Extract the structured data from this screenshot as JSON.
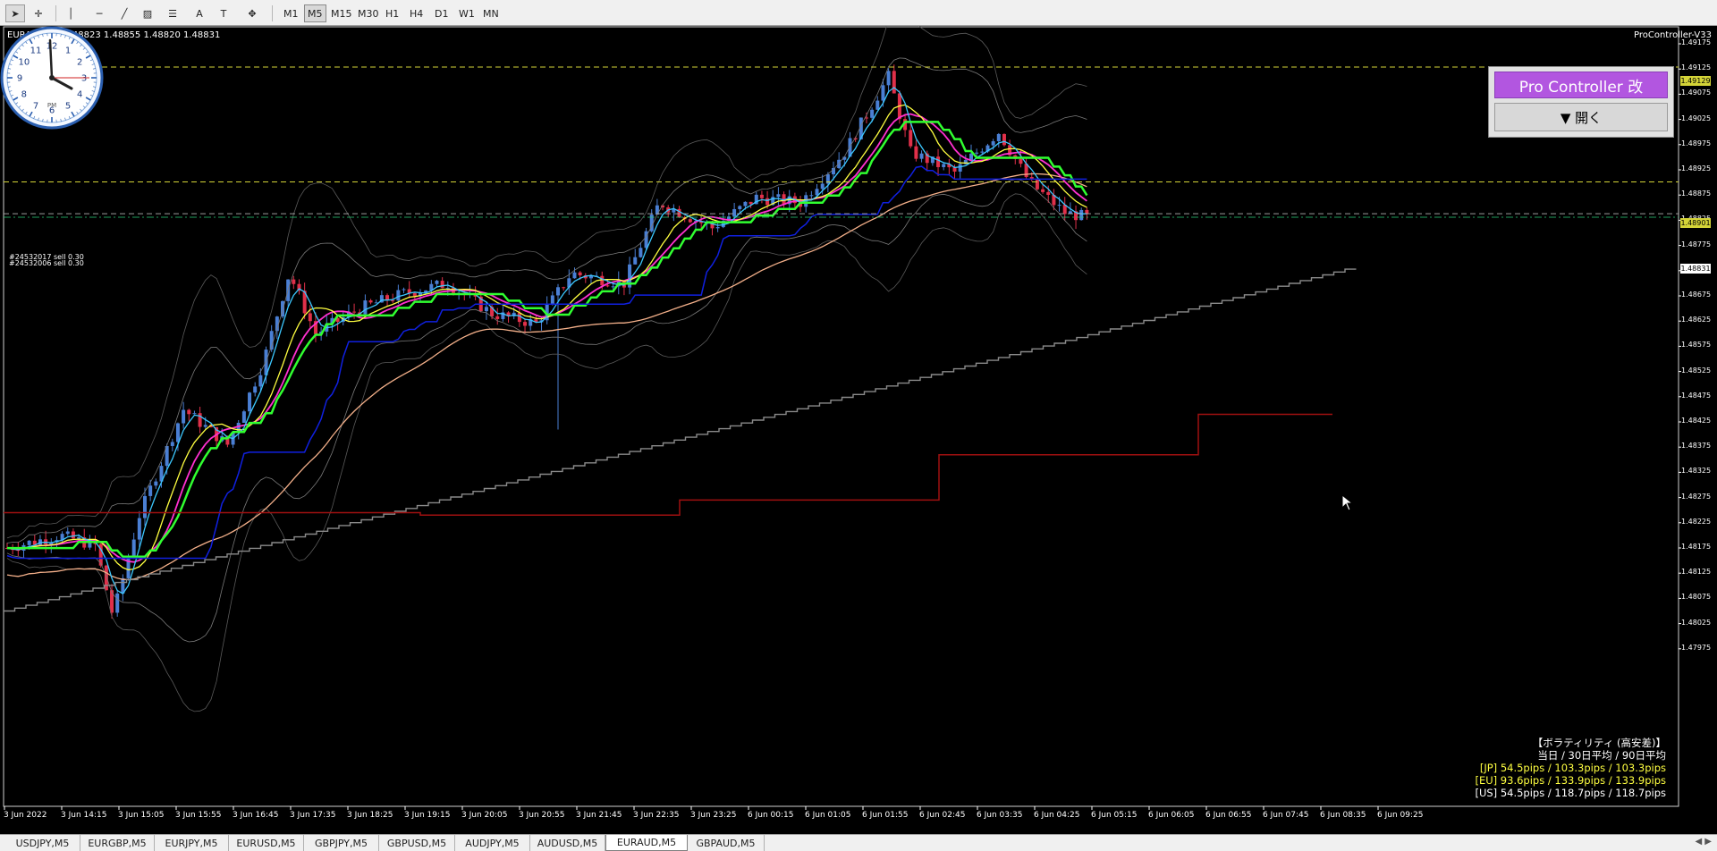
{
  "toolbar": {
    "tools": [
      {
        "name": "cursor-tool",
        "glyph": "➤"
      },
      {
        "name": "crosshair-tool",
        "glyph": "✛"
      },
      {
        "name": "vertical-line-tool",
        "glyph": "│"
      },
      {
        "name": "horizontal-line-tool",
        "glyph": "─"
      },
      {
        "name": "trendline-tool",
        "glyph": "╱"
      },
      {
        "name": "equidistant-channel-tool",
        "glyph": "▨"
      },
      {
        "name": "fibonacci-tool",
        "glyph": "☰"
      },
      {
        "name": "text-tool",
        "glyph": "A"
      },
      {
        "name": "text-label-tool",
        "glyph": "T"
      },
      {
        "name": "arrows-tool",
        "glyph": "✥"
      }
    ],
    "timeframes": [
      "M1",
      "M5",
      "M15",
      "M30",
      "H1",
      "H4",
      "D1",
      "W1",
      "MN"
    ],
    "active_timeframe": "M5"
  },
  "chart": {
    "symbol_info": "EURAUD,M5  1.48823 1.48855 1.48820 1.48831",
    "ea_name": "ProController-V33",
    "order_labels": [
      "#24532017 sell 0.30",
      "#24532006 sell 0.30"
    ],
    "price_axis": [
      "1.49175",
      "1.49125",
      "1.49075",
      "1.49025",
      "1.48975",
      "1.48925",
      "1.48875",
      "1.48825",
      "1.48775",
      "1.48725",
      "1.48675",
      "1.48625",
      "1.48575",
      "1.48525",
      "1.48475",
      "1.48425",
      "1.48375",
      "1.48325",
      "1.48275",
      "1.48225",
      "1.48175",
      "1.48125",
      "1.48075",
      "1.48025",
      "1.47975"
    ],
    "price_tags": {
      "upper_line": "1.49129",
      "middle_line": "1.48901",
      "bid": "1.48831"
    },
    "time_axis": [
      "3 Jun 2022",
      "3 Jun 14:15",
      "3 Jun 15:05",
      "3 Jun 15:55",
      "3 Jun 16:45",
      "3 Jun 17:35",
      "3 Jun 18:25",
      "3 Jun 19:15",
      "3 Jun 20:05",
      "3 Jun 20:55",
      "3 Jun 21:45",
      "3 Jun 22:35",
      "3 Jun 23:25",
      "6 Jun 00:15",
      "6 Jun 01:05",
      "6 Jun 01:55",
      "6 Jun 02:45",
      "6 Jun 03:35",
      "6 Jun 04:25",
      "6 Jun 05:15",
      "6 Jun 06:05",
      "6 Jun 06:55",
      "6 Jun 07:45",
      "6 Jun 08:35",
      "6 Jun 09:25"
    ],
    "colors": {
      "background": "#000000",
      "bull_candle": "#4a7fd4",
      "bear_candle": "#e0304a",
      "ma_fast": "#3cc8ff",
      "ma_yellow": "#ffff40",
      "ma_magenta": "#ff30d0",
      "ma_green": "#30ff30",
      "ma_slow": "#f4b08a",
      "step_blue": "#1020e0",
      "step_red": "#a01010",
      "step_gray": "#8a8a8a",
      "bands": "#7a7a7a",
      "dashed_line": "#d4d438"
    }
  },
  "pro_controller": {
    "title": "Pro Controller 改",
    "open_button": "▼ 開く"
  },
  "clock": {
    "numbers": [
      "12",
      "1",
      "2",
      "3",
      "4",
      "5",
      "6",
      "7",
      "8",
      "9",
      "10",
      "11"
    ],
    "period": "PM"
  },
  "volatility": {
    "title": "【ボラティリティ (高安差)】",
    "header": "当日 / 30日平均 / 90日平均",
    "rows": [
      {
        "label": "[JP] 54.5pips / 103.3pips / 103.3pips",
        "color": "#ffff40"
      },
      {
        "label": "[EU] 93.6pips / 133.9pips / 133.9pips",
        "color": "#ffff40"
      },
      {
        "label": "[US] 54.5pips / 118.7pips / 118.7pips",
        "color": "#ffffff"
      }
    ]
  },
  "tabs": {
    "items": [
      "USDJPY,M5",
      "EURGBP,M5",
      "EURJPY,M5",
      "EURUSD,M5",
      "GBPJPY,M5",
      "GBPUSD,M5",
      "AUDJPY,M5",
      "AUDUSD,M5",
      "EURAUD,M5",
      "GBPAUD,M5"
    ],
    "active": "EURAUD,M5"
  }
}
